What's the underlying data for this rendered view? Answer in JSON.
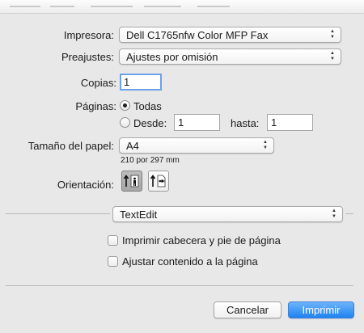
{
  "printer": {
    "label": "Impresora:",
    "value": "Dell C1765nfw Color MFP Fax"
  },
  "presets": {
    "label": "Preajustes:",
    "value": "Ajustes por omisión"
  },
  "copies": {
    "label": "Copias:",
    "value": "1"
  },
  "pages": {
    "label": "Páginas:",
    "all_label": "Todas",
    "from_label": "Desde:",
    "from_value": "1",
    "to_label": "hasta:",
    "to_value": "1",
    "selected": "all"
  },
  "paper_size": {
    "label": "Tamaño del papel:",
    "value": "A4",
    "dimensions": "210 por 297 mm"
  },
  "orientation": {
    "label": "Orientación:",
    "selected": "portrait"
  },
  "app_section": {
    "value": "TextEdit"
  },
  "options": [
    {
      "label": "Imprimir cabecera y pie de página",
      "checked": false
    },
    {
      "label": "Ajustar contenido a la página",
      "checked": false
    }
  ],
  "buttons": {
    "cancel": "Cancelar",
    "print": "Imprimir"
  },
  "icons": {
    "popup": "up-down-arrows-icon",
    "portrait": "portrait-orientation-icon",
    "landscape": "landscape-orientation-icon"
  },
  "colors": {
    "accent": "#1f83f0",
    "focus_ring": "#6fa1e9"
  }
}
